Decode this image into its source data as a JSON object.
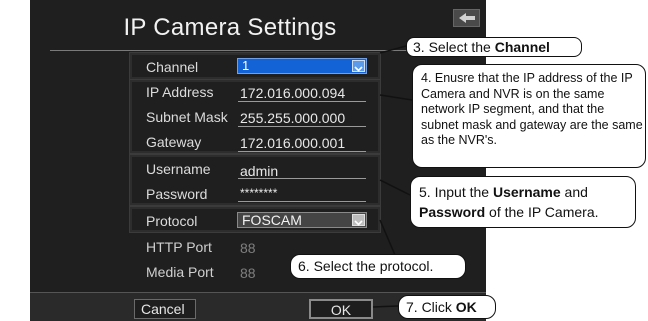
{
  "dialog": {
    "title": "IP Camera Settings",
    "buttons": {
      "cancel": "Cancel",
      "ok": "OK"
    }
  },
  "fields": {
    "channel": {
      "label": "Channel",
      "value": "1"
    },
    "ip_address": {
      "label": "IP Address",
      "value": "172.016.000.094"
    },
    "subnet_mask": {
      "label": "Subnet Mask",
      "value": "255.255.000.000"
    },
    "gateway": {
      "label": "Gateway",
      "value": "172.016.000.001"
    },
    "username": {
      "label": "Username",
      "value": "admin"
    },
    "password": {
      "label": "Password",
      "value": "********"
    },
    "protocol": {
      "label": "Protocol",
      "value": "FOSCAM"
    },
    "http_port": {
      "label": "HTTP Port",
      "value": "88"
    },
    "media_port": {
      "label": "Media Port",
      "value": "88"
    }
  },
  "callouts": {
    "step3": {
      "prefix": "3. Select the ",
      "bold": "Channel"
    },
    "step4": {
      "text": "4. Enusre that the IP address of the IP Camera and NVR is on the same network IP segment, and that the subnet mask and gateway are the same as the NVR's."
    },
    "step5": {
      "prefix": "5. Input the ",
      "bold1": "Username",
      "mid": " and ",
      "bold2": "Password",
      "suffix": " of the IP Camera."
    },
    "step6": {
      "text": "6. Select the protocol."
    },
    "step7": {
      "prefix": "7. Click ",
      "bold": "OK"
    }
  },
  "icons": {
    "back": "back-arrow-icon",
    "dropdown": "chevron-down-icon"
  },
  "colors": {
    "dialog_bg": "#1f1f1f",
    "selected_blue": "#1463d6",
    "callout_border": "#111111"
  }
}
